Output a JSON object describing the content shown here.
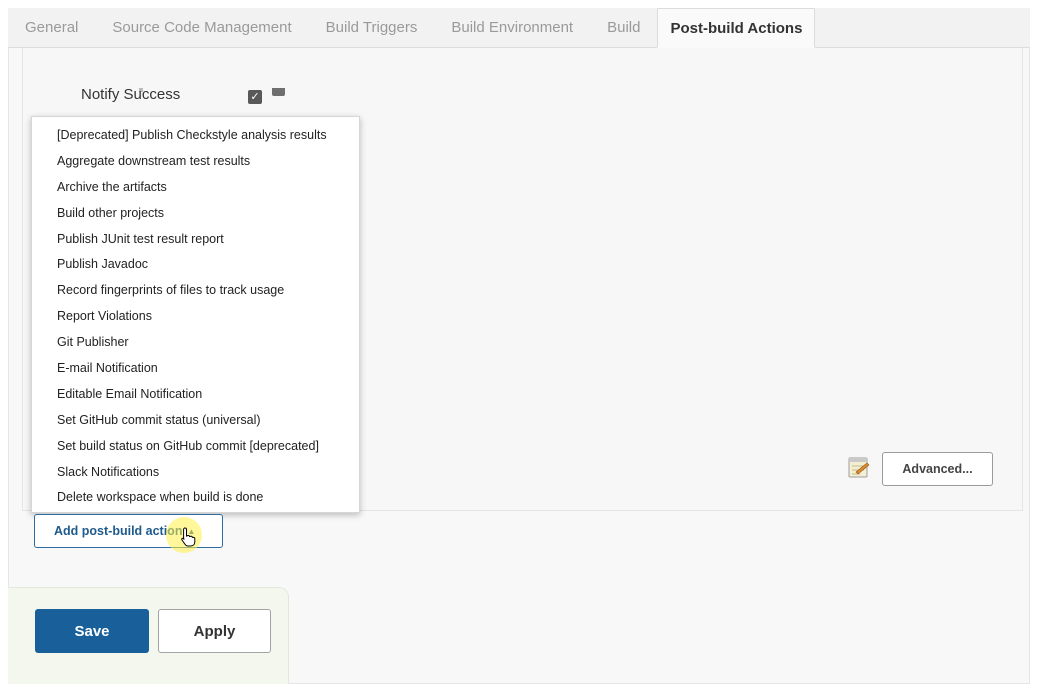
{
  "tabs": [
    {
      "label": "General"
    },
    {
      "label": "Source Code Management"
    },
    {
      "label": "Build Triggers"
    },
    {
      "label": "Build Environment"
    },
    {
      "label": "Build"
    },
    {
      "label": "Post-build Actions"
    }
  ],
  "active_tab": "Post-build Actions",
  "notify_success": {
    "label": "Notify Success",
    "checked": true,
    "check_glyph": "✓"
  },
  "menu": {
    "items": [
      "[Deprecated] Publish Checkstyle analysis results",
      "Aggregate downstream test results",
      "Archive the artifacts",
      "Build other projects",
      "Publish JUnit test result report",
      "Publish Javadoc",
      "Record fingerprints of files to track usage",
      "Report Violations",
      "Git Publisher",
      "E-mail Notification",
      "Editable Email Notification",
      "Set GitHub commit status (universal)",
      "Set build status on GitHub commit [deprecated]",
      "Slack Notifications",
      "Delete workspace when build is done"
    ]
  },
  "advanced_button": {
    "label": "Advanced...",
    "icon": "notepad-icon"
  },
  "add_action_button": {
    "label": "Add post-build action",
    "caret": "▲"
  },
  "footer": {
    "save_label": "Save",
    "apply_label": "Apply"
  },
  "colors": {
    "primary": "#19609a",
    "link": "#1f5a8c",
    "highlight": "#fff046"
  }
}
